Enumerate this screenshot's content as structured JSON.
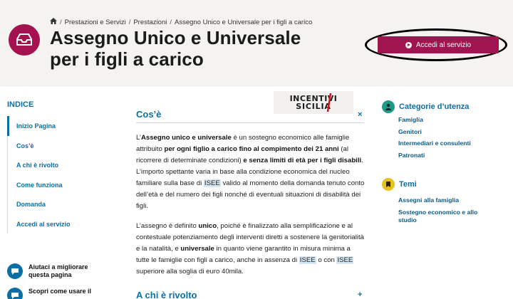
{
  "breadcrumb": {
    "items": [
      "Prestazioni e Servizi",
      "Prestazioni",
      "Assegno Unico e Universale per i figli a carico"
    ]
  },
  "page": {
    "title_line1": "Assegno Unico e Universale",
    "title_line2": "per i figli a carico"
  },
  "access_button": {
    "label": "Accedi al servizio"
  },
  "index": {
    "title": "INDICE",
    "items": [
      "Inizio Pagina",
      "Cos’è",
      "A chi è rivolto",
      "Come funziona",
      "Domanda",
      "Accedi al servizio"
    ]
  },
  "help": {
    "improve": "Aiutaci a migliorare questa pagina",
    "discover": "Scopri come usare il"
  },
  "logo": {
    "top": "INCENTIVI",
    "bottom": "SICILIA"
  },
  "sections": {
    "cose": {
      "title": "Cos’è",
      "toggle": "×"
    },
    "a_chi": {
      "title": "A chi è rivolto",
      "toggle": "+"
    }
  },
  "content": {
    "p1": [
      "L’",
      {
        "b": "Assegno unico e universale"
      },
      " è un sostegno economico alle famiglie attribuito ",
      {
        "b": "per ogni figlio a carico fino al compimento dei 21 anni"
      },
      " (al ricorrere di determinate condizioni) ",
      {
        "b": "e senza limiti di età per i figli disabili"
      },
      ". L’importo spettante varia in base alla condizione economica del nucleo familiare sulla base di ",
      {
        "hl": "ISEE"
      },
      " valido al momento della domanda tenuto conto dell’età e del numero dei figli nonché di eventuali situazioni di disabilità dei figli."
    ],
    "p2": [
      "L’assegno è definito ",
      {
        "b": "unico"
      },
      ", poiché è finalizzato alla semplificazione e al contestuale potenziamento degli interventi diretti a sostenere la genitorialità e la natalità, e ",
      {
        "b": "universale"
      },
      " in quanto viene garantito in misura minima a tutte le famiglie con figli a carico, anche in assenza di ",
      {
        "hl": "ISEE"
      },
      " o con ",
      {
        "hl": "ISEE"
      },
      " superiore alla soglia di euro 40mila."
    ]
  },
  "categories": {
    "title": "Categorie d’utenza",
    "items": [
      "Famiglia",
      "Genitori",
      "Intermediari e consulenti",
      "Patronati"
    ]
  },
  "topics": {
    "title": "Temi",
    "items": [
      "Assegni alla famiglia",
      "Sostegno economico e allo studio"
    ]
  },
  "colors": {
    "brand_magenta": "#a01550",
    "link_blue": "#0b6fa4",
    "header_bg": "#f4f3ef",
    "category_teal": "#1f9a86",
    "topic_yellow": "#e8c21d"
  },
  "icons": {
    "service": "inbox-tray-icon",
    "home": "home-icon",
    "button": "play-circle-icon",
    "categories": "user-icon",
    "topics": "tag-icon",
    "help": "chat-bubble-icon"
  }
}
